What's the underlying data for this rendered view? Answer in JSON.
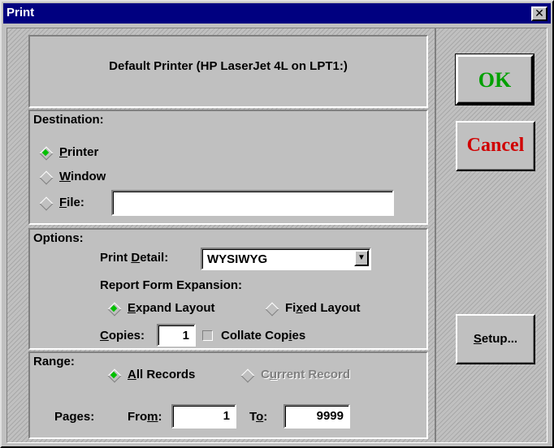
{
  "window": {
    "title": "Print",
    "close_glyph": "✕"
  },
  "default_printer": "Default Printer (HP LaserJet 4L on LPT1:)",
  "destination": {
    "title": "Destination:",
    "printer": {
      "pre": "",
      "key": "P",
      "post": "rinter",
      "selected": true
    },
    "window": {
      "pre": "",
      "key": "W",
      "post": "indow",
      "selected": false
    },
    "file": {
      "pre": "",
      "key": "F",
      "post": "ile:",
      "selected": false
    },
    "file_value": ""
  },
  "options": {
    "title": "Options:",
    "print_detail": {
      "pre": "Print ",
      "key": "D",
      "post": "etail:"
    },
    "print_detail_value": "WYSIWYG",
    "expansion_label": "Report Form Expansion:",
    "expand_layout": {
      "pre": "",
      "key": "E",
      "post": "xpand Layout",
      "selected": true
    },
    "fixed_layout": {
      "pre": "Fi",
      "key": "x",
      "post": "ed Layout",
      "selected": false
    },
    "copies": {
      "pre": "",
      "key": "C",
      "post": "opies:"
    },
    "copies_value": "1",
    "collate": {
      "pre": "Collate Cop",
      "key": "i",
      "post": "es",
      "checked": false
    }
  },
  "range": {
    "title": "Range:",
    "all_records": {
      "pre": "",
      "key": "A",
      "post": "ll Records",
      "selected": true
    },
    "current_record": {
      "pre": "C",
      "key": "u",
      "post": "rrent Record",
      "selected": false,
      "disabled": true
    },
    "pages_label": "Pages:",
    "from": {
      "pre": "Fro",
      "key": "m",
      "post": ":"
    },
    "from_value": "1",
    "to": {
      "pre": "T",
      "key": "o",
      "post": ":"
    },
    "to_value": "9999"
  },
  "buttons": {
    "ok": "OK",
    "cancel": "Cancel",
    "setup": {
      "pre": "",
      "key": "S",
      "post": "etup..."
    }
  },
  "colors": {
    "titlebar": "#000080",
    "ok": "#00a000",
    "cancel": "#d00000",
    "radio_on": "#00c000"
  }
}
